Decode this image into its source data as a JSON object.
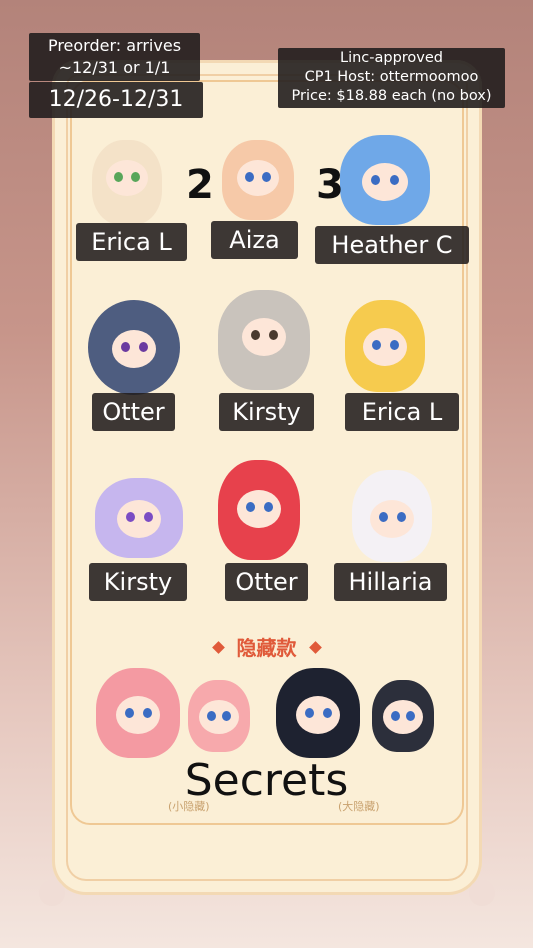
{
  "overlays": {
    "preorder_line1": "Preorder: arrives",
    "preorder_line2": "~12/31 or 1/1",
    "dates": "12/26-12/31",
    "info_line1": "Linc-approved",
    "info_line2": "CP1 Host: ottermoomoo",
    "info_line3": "Price: $18.88 each (no box)"
  },
  "numbers": [
    "2",
    "3"
  ],
  "names": {
    "r1c1": "Erica L",
    "r1c2": "Aiza",
    "r1c3": "Heather C",
    "r2c1": "Otter",
    "r2c2": "Kirsty",
    "r2c3": "Erica L",
    "r3c1": "Kirsty",
    "r3c2": "Otter",
    "r3c3": "Hillaria"
  },
  "hidden_section": {
    "title": "隐藏款",
    "secrets_label": "Secrets",
    "left_caption": "(小隐藏)",
    "right_caption": "(大隐藏)"
  },
  "colors": {
    "panel": "#fbefd6",
    "accent": "#e05a3a",
    "overlay": "#221e1e"
  }
}
